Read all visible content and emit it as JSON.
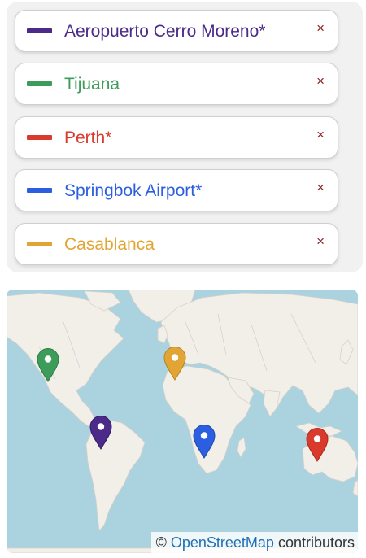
{
  "locations": [
    {
      "label": "Aeropuerto Cerro Moreno*",
      "color": "#4b2a8a",
      "icon": "close-icon",
      "close_glyph": "×"
    },
    {
      "label": "Tijuana",
      "color": "#3e9c5a",
      "icon": "close-icon",
      "close_glyph": "×"
    },
    {
      "label": "Perth*",
      "color": "#d93a2b",
      "icon": "close-icon",
      "close_glyph": "×"
    },
    {
      "label": "Springbok Airport*",
      "color": "#2c5fe0",
      "icon": "close-icon",
      "close_glyph": "×"
    },
    {
      "label": "Casablanca",
      "color": "#e2a533",
      "icon": "close-icon",
      "close_glyph": "×"
    }
  ],
  "map": {
    "attribution": {
      "prefix": "© ",
      "link": "OpenStreetMap",
      "suffix": " contributors"
    },
    "water_color": "#aad3df",
    "land_color": "#f2efe9"
  }
}
